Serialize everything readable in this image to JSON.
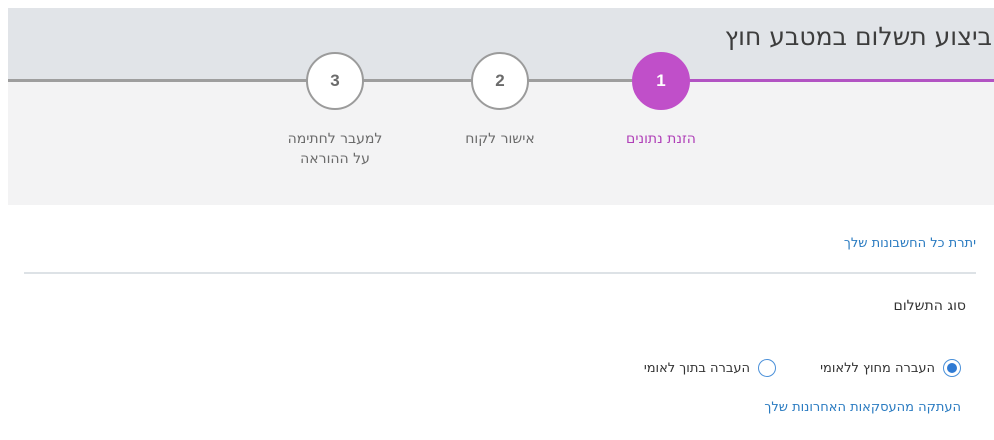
{
  "header": {
    "title": "ביצוע תשלום במטבע חוץ"
  },
  "steps": [
    {
      "number": "1",
      "label": "הזנת נתונים",
      "state": "active"
    },
    {
      "number": "2",
      "label": "אישור לקוח",
      "state": "inactive"
    },
    {
      "number": "3",
      "label": "למעבר לחתימה\nעל ההוראה",
      "state": "inactive"
    }
  ],
  "balances_link": "יתרת כל החשבונות שלך",
  "payment_type": {
    "title": "סוג התשלום",
    "options": [
      {
        "label": "העברה מחוץ ללאומי",
        "selected": true
      },
      {
        "label": "העברה בתוך לאומי",
        "selected": false
      }
    ]
  },
  "copy_link": "העתקה מהעסקאות האחרונות שלך",
  "colors": {
    "accent": "#c04fc9",
    "link": "#2a7bc1",
    "radio": "#2f7ad3"
  }
}
